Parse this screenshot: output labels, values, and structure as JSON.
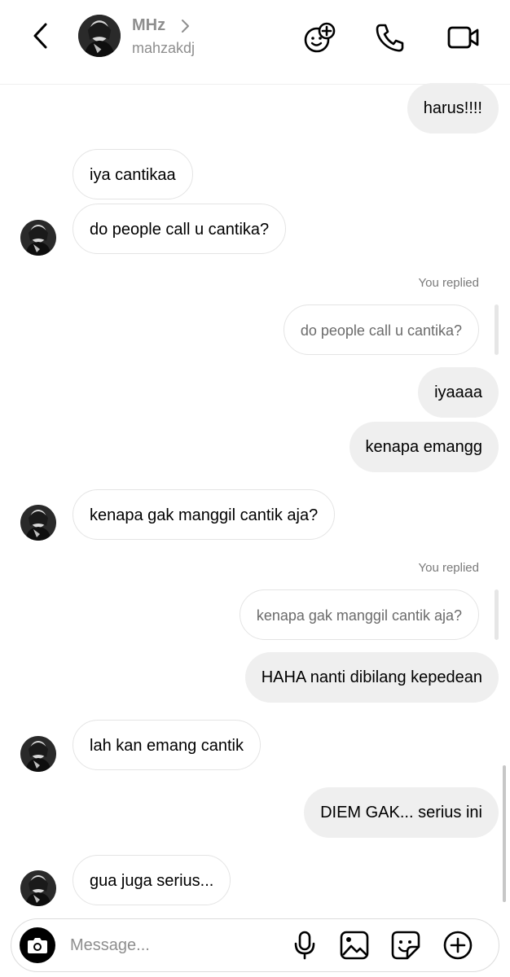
{
  "header": {
    "name": "MHz",
    "username": "mahzakdj"
  },
  "messages": [
    {
      "text": "harus!!!!"
    },
    {
      "text": "iya cantikaa"
    },
    {
      "text": "do people call u cantika?"
    },
    {
      "replied_label": "You replied",
      "quoted": "do people call u cantika?"
    },
    {
      "text": "iyaaaa"
    },
    {
      "text": "kenapa emangg"
    },
    {
      "text": "kenapa gak manggil cantik aja?"
    },
    {
      "replied_label": "You replied",
      "quoted": "kenapa gak manggil cantik aja?"
    },
    {
      "text": "HAHA nanti dibilang kepedean"
    },
    {
      "text": "lah kan emang cantik"
    },
    {
      "text": "DIEM GAK... serius ini"
    },
    {
      "text": "gua juga serius..."
    }
  ],
  "composer": {
    "placeholder": "Message..."
  },
  "icons": {
    "back": "chevron-left-icon",
    "profile_chevron": "chevron-right-icon",
    "effects": "sticker-plus-icon",
    "call": "phone-icon",
    "video": "video-camera-icon",
    "camera": "camera-icon",
    "mic": "microphone-icon",
    "gallery": "image-icon",
    "sticker": "sticker-icon",
    "add": "plus-circle-icon"
  },
  "colors": {
    "outgoing_bubble": "#efefef",
    "incoming_border": "#e4e4e4",
    "muted_text": "#8e8e8e"
  }
}
